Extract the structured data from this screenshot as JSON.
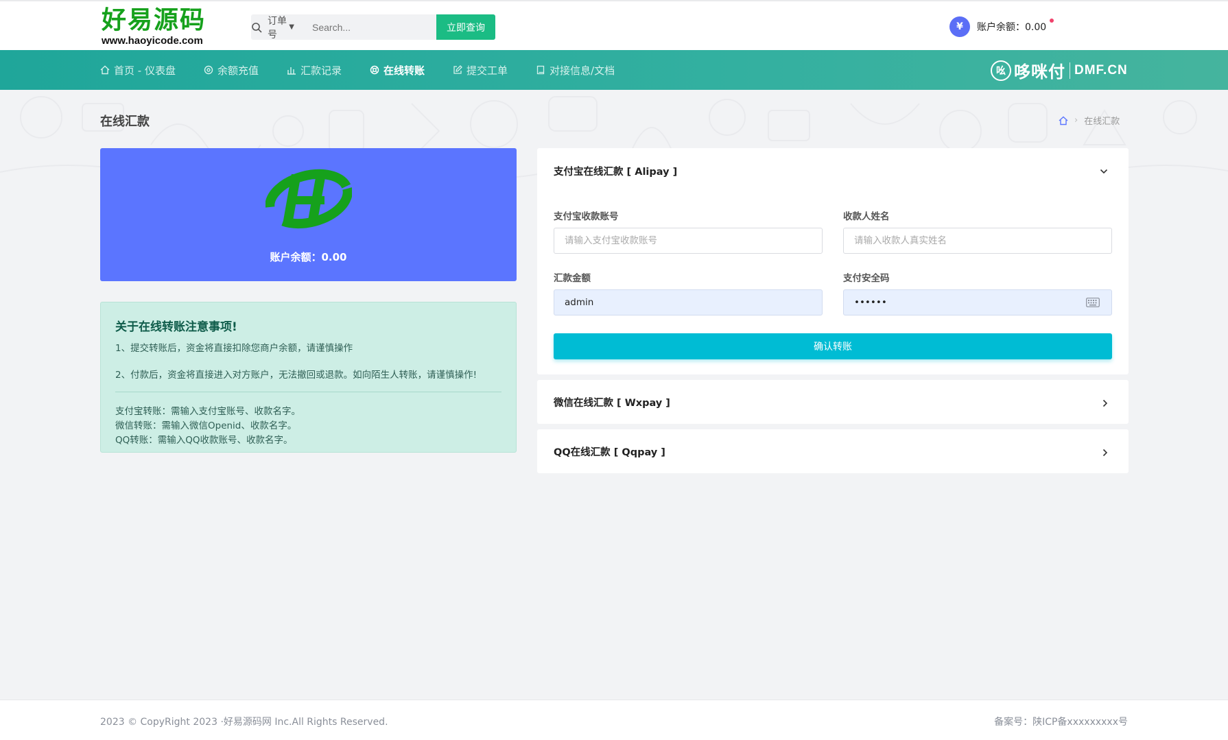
{
  "header": {
    "logo_cn": "好易源码",
    "logo_url": "www.haoyicode.com",
    "search_type": "订单号",
    "search_placeholder": "Search...",
    "search_button": "立即查询",
    "balance_label": "账户余额：0.00",
    "avatar_symbol": "¥"
  },
  "nav": {
    "items": [
      {
        "label": "首页 - 仪表盘",
        "icon": "home-icon"
      },
      {
        "label": "余额充值",
        "icon": "target-icon"
      },
      {
        "label": "汇款记录",
        "icon": "bar-chart-icon"
      },
      {
        "label": "在线转账",
        "icon": "lifebuoy-icon",
        "active": true
      },
      {
        "label": "提交工单",
        "icon": "edit-icon"
      },
      {
        "label": "对接信息/文档",
        "icon": "book-icon"
      }
    ],
    "brand_mark": "吆",
    "brand_cn": "哆咪付",
    "brand_en": "DMF.CN"
  },
  "page": {
    "title": "在线汇款",
    "breadcrumb_current": "在线汇款"
  },
  "balance_card": {
    "text": "账户余额：0.00"
  },
  "notice": {
    "title": "关于在线转账注意事项!",
    "line1": "1、提交转账后，资金将直接扣除您商户余额，请谨慎操作",
    "line2": "2、付款后，资金将直接进入对方账户，无法撤回或退款。如向陌生人转账，请谨慎操作!",
    "alipay_note": "支付宝转账：需输入支付宝账号、收款名字。",
    "wechat_note": "微信转账：需输入微信Openid、收款名字。",
    "qq_note": "QQ转账：需输入QQ收款账号、收款名字。"
  },
  "alipay_panel": {
    "title": "支付宝在线汇款 [ Alipay ]",
    "account_label": "支付宝收款账号",
    "account_placeholder": "请输入支付宝收款账号",
    "name_label": "收款人姓名",
    "name_placeholder": "请输入收款人真实姓名",
    "amount_label": "汇款金额",
    "amount_value": "admin",
    "pin_label": "支付安全码",
    "pin_value": "••••••",
    "submit_label": "确认转账"
  },
  "wechat_panel": {
    "title": "微信在线汇款 [ Wxpay ]"
  },
  "qq_panel": {
    "title": "QQ在线汇款 [ Qqpay ]"
  },
  "footer": {
    "copyright": "2023 © CopyRight 2023 ·好易源码网 Inc.All Rights Reserved.",
    "icp": "备案号：陕ICP备xxxxxxxxx号"
  },
  "colors": {
    "brand_green": "#16a11c",
    "nav_teal": "#1fa69a",
    "search_button": "#1bbc84",
    "balance_card": "#5b75ff",
    "submit_button": "#00bcd4",
    "notice_bg": "#cdeee5"
  }
}
